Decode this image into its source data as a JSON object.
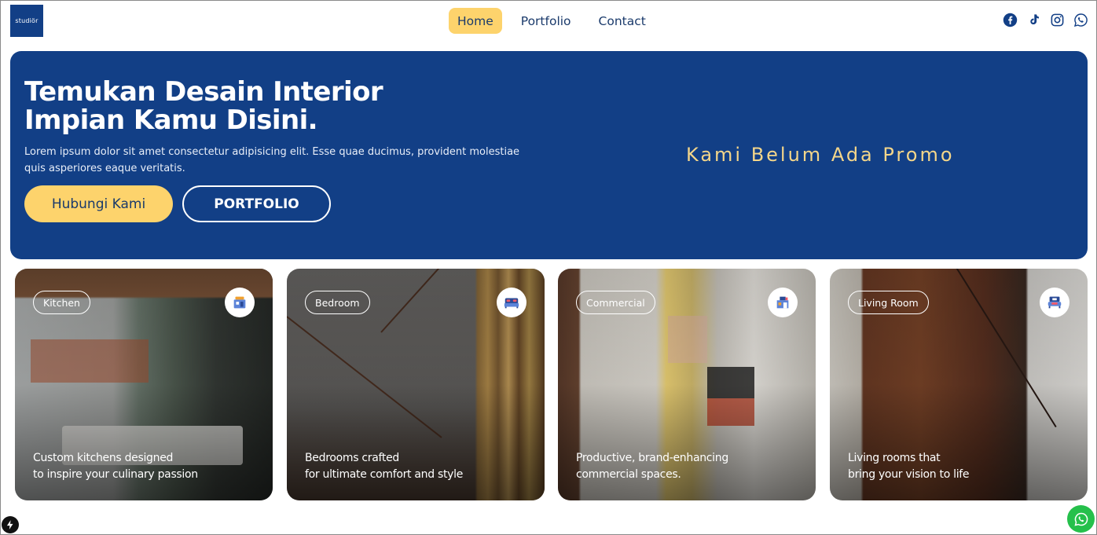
{
  "brand": {
    "logo_text": "studiör"
  },
  "nav": {
    "items": [
      {
        "label": "Home"
      },
      {
        "label": "Portfolio"
      },
      {
        "label": "Contact"
      }
    ]
  },
  "socials": [
    "facebook-icon",
    "tiktok-icon",
    "instagram-icon",
    "whatsapp-icon"
  ],
  "hero": {
    "title_line1": "Temukan Desain Interior",
    "title_line2": "Impian Kamu Disini.",
    "description": "Lorem ipsum dolor sit amet consectetur adipisicing elit. Esse quae ducimus, provident molestiae quis asperiores eaque veritatis.",
    "btn_contact": "Hubungi Kami",
    "btn_portfolio": "PORTFOLIO",
    "promo": "Kami Belum Ada Promo"
  },
  "cards": [
    {
      "tag": "Kitchen",
      "icon": "kitchen-icon",
      "line1": "Custom kitchens designed",
      "line2": "to inspire your culinary passion"
    },
    {
      "tag": "Bedroom",
      "icon": "bed-icon",
      "line1": "Bedrooms crafted",
      "line2": "for ultimate comfort and style"
    },
    {
      "tag": "Commercial",
      "icon": "store-icon",
      "line1": "Productive, brand-enhancing",
      "line2": "commercial spaces."
    },
    {
      "tag": "Living Room",
      "icon": "sofa-icon",
      "line1": "Living rooms that",
      "line2": "bring your vision to life"
    }
  ],
  "colors": {
    "primary": "#123f86",
    "accent": "#fdd36c",
    "whatsapp": "#25c04b"
  }
}
